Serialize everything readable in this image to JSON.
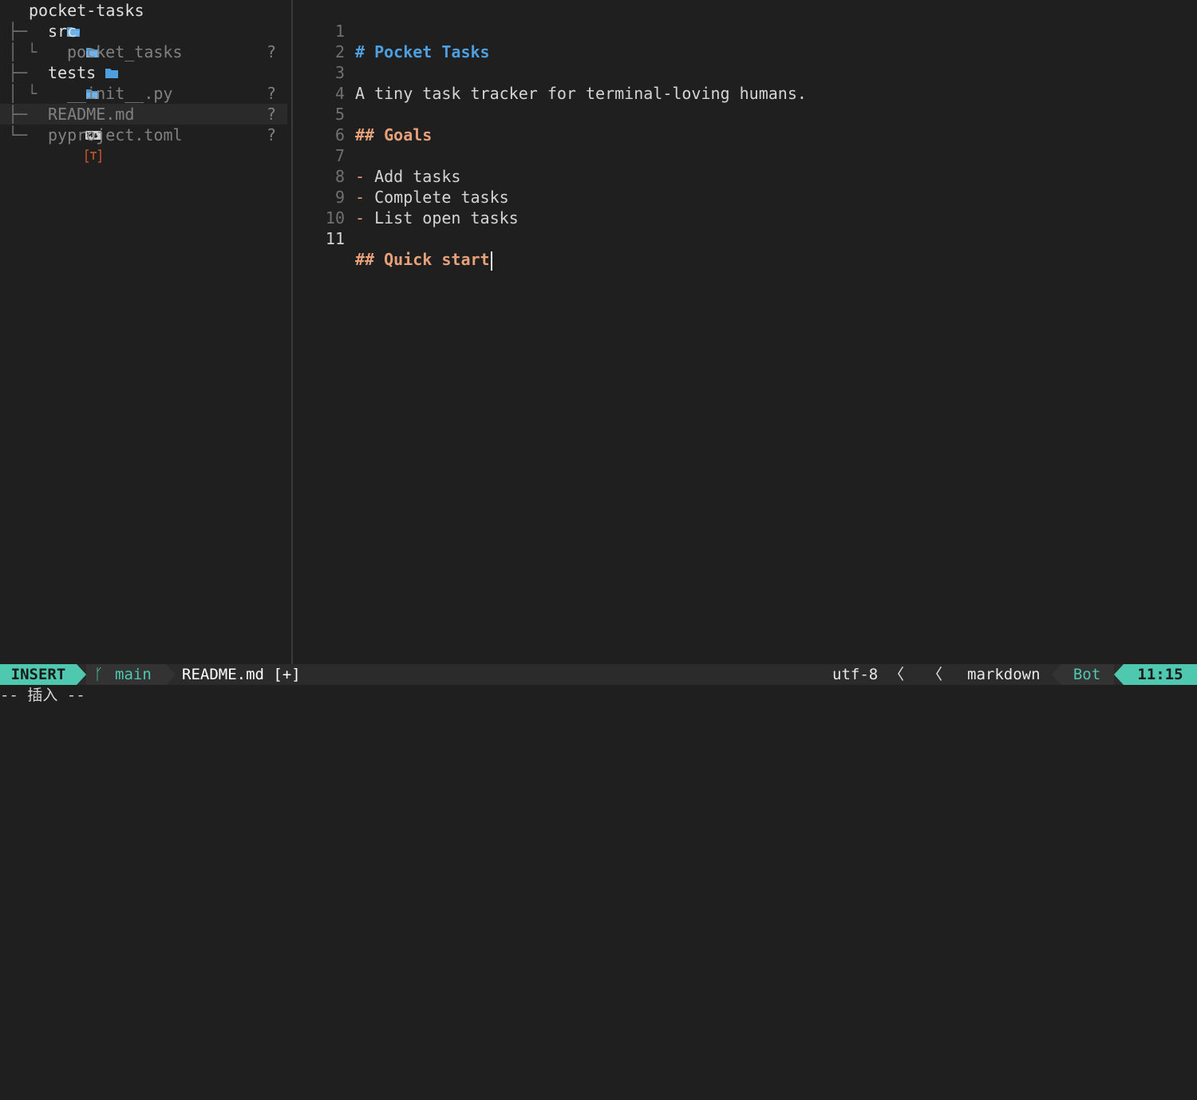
{
  "tree": {
    "root": "pocket-tasks",
    "items": [
      {
        "label": "src",
        "status": ""
      },
      {
        "label": "pocket_tasks",
        "status": "?"
      },
      {
        "label": "tests",
        "status": ""
      },
      {
        "label": "__init__.py",
        "status": "?"
      },
      {
        "label": "README.md",
        "status": "?"
      },
      {
        "label": "pyproject.toml",
        "status": "?"
      }
    ]
  },
  "editor": {
    "lines": [
      {
        "num": "1",
        "parts": [
          "#",
          "Pocket Tasks"
        ]
      },
      {
        "num": "2",
        "text": ""
      },
      {
        "num": "3",
        "text": "A tiny task tracker for terminal-loving humans."
      },
      {
        "num": "4",
        "text": ""
      },
      {
        "num": "5",
        "parts": [
          "##",
          "Goals"
        ]
      },
      {
        "num": "6",
        "text": ""
      },
      {
        "num": "7",
        "parts": [
          "-",
          "Add tasks"
        ]
      },
      {
        "num": "8",
        "parts": [
          "-",
          "Complete tasks"
        ]
      },
      {
        "num": "9",
        "parts": [
          "-",
          "List open tasks"
        ]
      },
      {
        "num": "10",
        "text": ""
      },
      {
        "num": "11",
        "parts": [
          "##",
          "Quick start"
        ]
      }
    ]
  },
  "statusline": {
    "mode": "INSERT",
    "branch": "main",
    "filename": "README.md [+]",
    "encoding": "utf-8",
    "filetype": "markdown",
    "scroll": "Bot",
    "position": "11:15"
  },
  "cmdline": "-- 插入 --",
  "colors": {
    "accent": "#4ec9b0",
    "heading1": "#4e9fe0",
    "heading2": "#e6a07a",
    "folder": "#4e9fe0",
    "python": "#f0c040",
    "toml": "#c0502a"
  }
}
